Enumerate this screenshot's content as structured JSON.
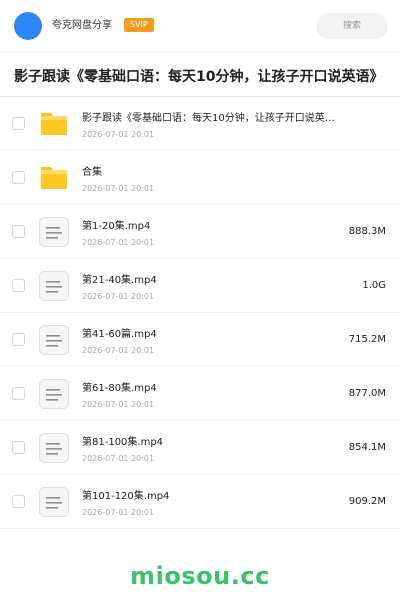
{
  "header": {
    "app_name": "夸克网盘分享",
    "badge": "SVIP",
    "search_placeholder": "搜索",
    "accent_color": "#2f86f6",
    "badge_color": "#f59a23"
  },
  "page": {
    "title": "影子跟读《零基础口语：每天10分钟，让孩子开口说英语》"
  },
  "files": [
    {
      "type": "folder",
      "icon": "folder-icon",
      "name": "影子跟读《零基础口语：每天10分钟，让孩子开口说英…",
      "date": "2026-07-01 20:01",
      "size": ""
    },
    {
      "type": "folder",
      "icon": "folder-icon",
      "name": "合集",
      "date": "2026-07-01 20:01",
      "size": ""
    },
    {
      "type": "file",
      "icon": "document-icon",
      "name": "第1-20集.mp4",
      "date": "2026-07-01 20:01",
      "size": "888.3M"
    },
    {
      "type": "file",
      "icon": "document-icon",
      "name": "第21-40集.mp4",
      "date": "2026-07-01 20:01",
      "size": "1.0G"
    },
    {
      "type": "file",
      "icon": "document-icon",
      "name": "第41-60篇.mp4",
      "date": "2026-07-01 20:01",
      "size": "715.2M"
    },
    {
      "type": "file",
      "icon": "document-icon",
      "name": "第61-80集.mp4",
      "date": "2026-07-01 20:01",
      "size": "877.0M"
    },
    {
      "type": "file",
      "icon": "document-icon",
      "name": "第81-100集.mp4",
      "date": "2026-07-01 20:01",
      "size": "854.1M"
    },
    {
      "type": "file",
      "icon": "document-icon",
      "name": "第101-120集.mp4",
      "date": "2026-07-01 20:01",
      "size": "909.2M"
    }
  ],
  "watermark": "miosou.cc"
}
